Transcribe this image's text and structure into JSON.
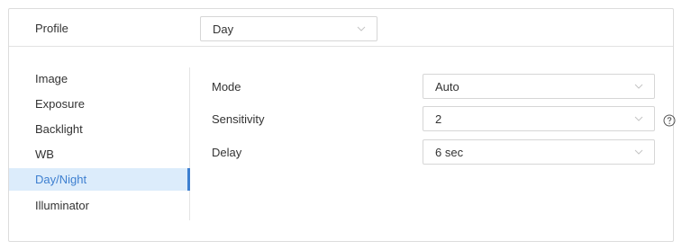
{
  "profile": {
    "label": "Profile",
    "selected": "Day"
  },
  "sidebar": {
    "items": [
      {
        "label": "Image",
        "active": false
      },
      {
        "label": "Exposure",
        "active": false
      },
      {
        "label": "Backlight",
        "active": false
      },
      {
        "label": "WB",
        "active": false
      },
      {
        "label": "Day/Night",
        "active": true
      },
      {
        "label": "Illuminator",
        "active": false
      }
    ]
  },
  "form": {
    "mode": {
      "label": "Mode",
      "value": "Auto"
    },
    "sensitivity": {
      "label": "Sensitivity",
      "value": "2"
    },
    "delay": {
      "label": "Delay",
      "value": "6 sec"
    }
  },
  "icons": {
    "help": "help-circle-icon",
    "dropdown": "chevron-down-icon"
  },
  "colors": {
    "accent": "#3d7fd0",
    "active_bg": "#dcecfb",
    "border": "#d6d6d6"
  }
}
